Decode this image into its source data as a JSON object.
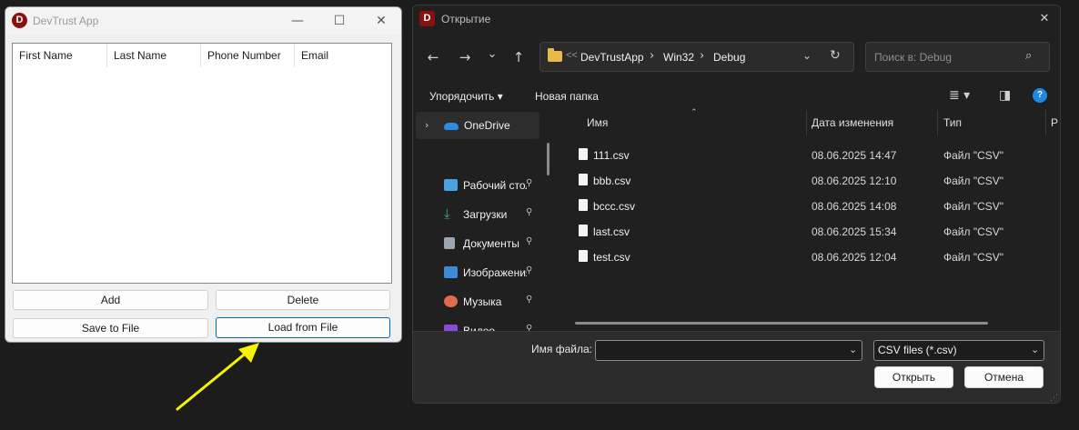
{
  "app": {
    "title": "DevTrust App",
    "logo": "D",
    "controls": {
      "minimize": "—",
      "maximize": "☐",
      "close": "✕"
    },
    "columns": [
      "First Name",
      "Last Name",
      "Phone Number",
      "Email"
    ],
    "buttons": {
      "add": "Add",
      "delete": "Delete",
      "save": "Save to File",
      "load": "Load from File"
    },
    "annotation_arrow_color": "#f5f500"
  },
  "dialog": {
    "title": "Открытие",
    "logo": "D",
    "close": "✕",
    "nav": {
      "back": "←",
      "forward": "→",
      "recent": "⌄",
      "up": "↑"
    },
    "address": {
      "overflow": "<<",
      "crumbs": [
        "DevTrustApp",
        "Win32",
        "Debug"
      ],
      "crumb_sep": "›",
      "dropdown": "⌄",
      "refresh": "↻"
    },
    "search_placeholder": "Поиск в: Debug",
    "search_icon": "⌕",
    "toolbar": {
      "organize": "Упорядочить ▾",
      "new_folder": "Новая папка",
      "view_icon": "≣ ▾",
      "preview_icon": "◨",
      "help_icon": "?"
    },
    "sidebar": {
      "onedrive": "OneDrive",
      "items": [
        {
          "label": "Рабочий стол",
          "icon": "desktop-icon",
          "color": "#4aa3df"
        },
        {
          "label": "Загрузки",
          "icon": "download-icon",
          "color": "#2fb36b"
        },
        {
          "label": "Документы",
          "icon": "document-icon",
          "color": "#9aa6b2"
        },
        {
          "label": "Изображения",
          "icon": "image-icon",
          "color": "#3d8bd4"
        },
        {
          "label": "Музыка",
          "icon": "music-icon",
          "color": "#e06b4f"
        },
        {
          "label": "Видео",
          "icon": "video-icon",
          "color": "#8a4bd6"
        }
      ],
      "pin": "📌"
    },
    "file_columns": {
      "name": "Имя",
      "date": "Дата изменения",
      "type": "Тип",
      "size": "Р"
    },
    "files": [
      {
        "name": "111.csv",
        "date": "08.06.2025 14:47",
        "type": "Файл \"CSV\""
      },
      {
        "name": "bbb.csv",
        "date": "08.06.2025 12:10",
        "type": "Файл \"CSV\""
      },
      {
        "name": "bccc.csv",
        "date": "08.06.2025 14:08",
        "type": "Файл \"CSV\""
      },
      {
        "name": "last.csv",
        "date": "08.06.2025 15:34",
        "type": "Файл \"CSV\""
      },
      {
        "name": "test.csv",
        "date": "08.06.2025 12:04",
        "type": "Файл \"CSV\""
      }
    ],
    "filename_label": "Имя файла:",
    "filename_value": "",
    "filter": "CSV files (*.csv)",
    "open_button": "Открыть",
    "cancel_button": "Отмена"
  }
}
